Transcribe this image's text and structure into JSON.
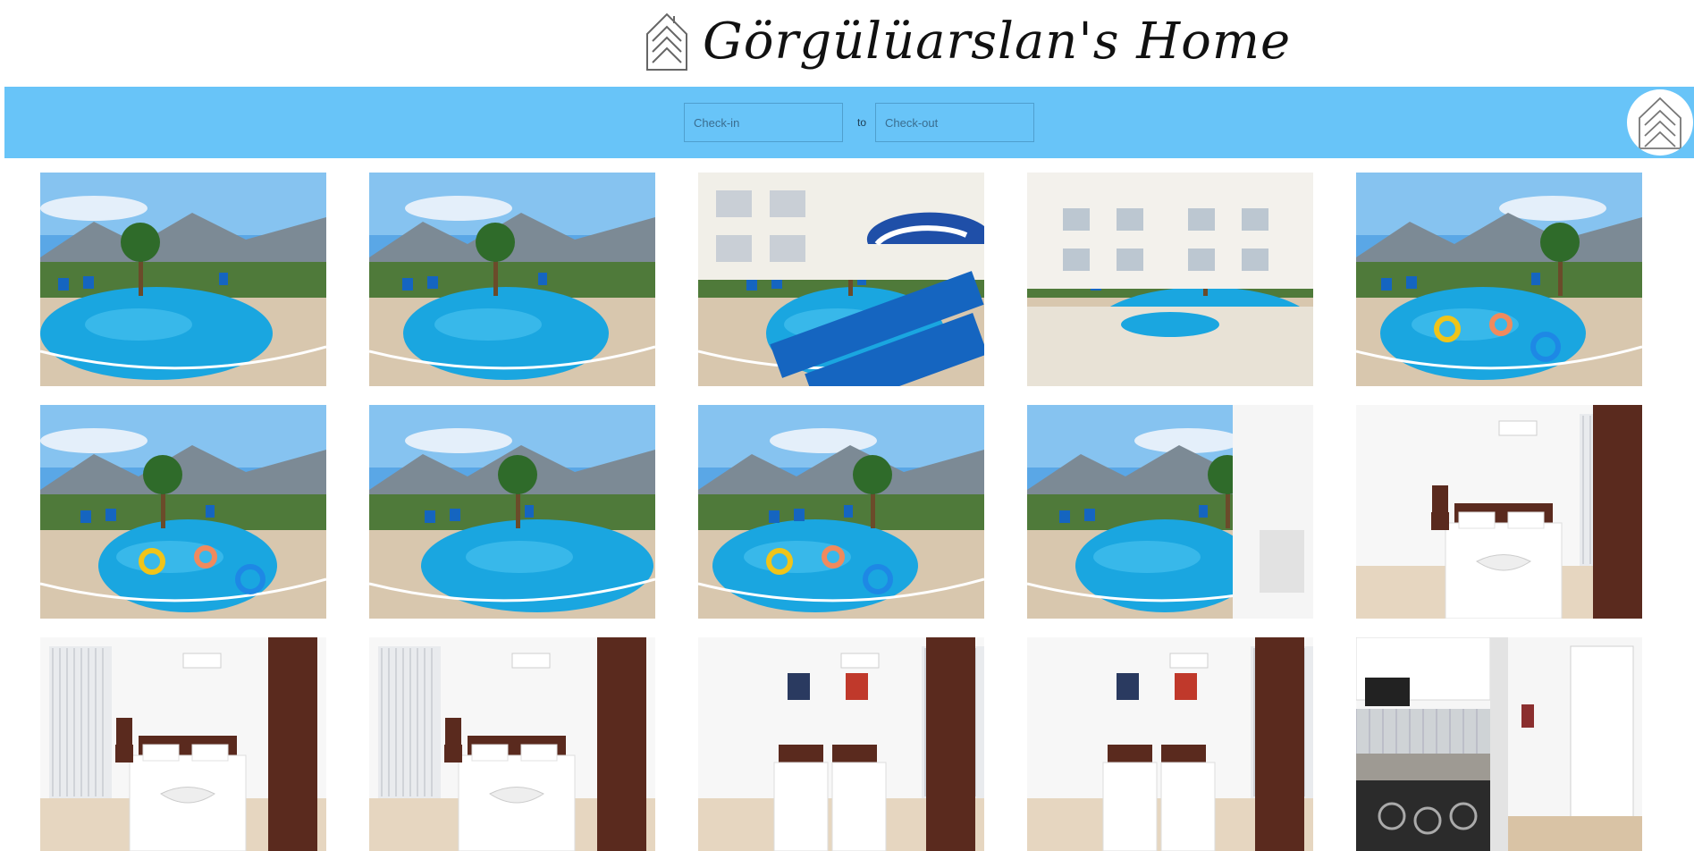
{
  "site": {
    "title": "Görgülüarslan's Home",
    "logo_icon": "house-outline-icon"
  },
  "booking": {
    "checkin_placeholder": "Check-in",
    "to_label": "to",
    "checkout_placeholder": "Check-out",
    "corner_icon": "house-outline-icon"
  },
  "gallery": {
    "photos": [
      {
        "kind": "pool",
        "variant": "wide-pool-mountains"
      },
      {
        "kind": "pool",
        "variant": "pool-garden-banana"
      },
      {
        "kind": "pool",
        "variant": "blue-loungers-umbrella"
      },
      {
        "kind": "pool",
        "variant": "building-jacuzzi"
      },
      {
        "kind": "pool",
        "variant": "pool-floats-sunset"
      },
      {
        "kind": "pool",
        "variant": "pool-floats-closeup"
      },
      {
        "kind": "pool",
        "variant": "pool-clouds-mountains"
      },
      {
        "kind": "pool",
        "variant": "pool-floats-sun"
      },
      {
        "kind": "pool",
        "variant": "pool-from-balcony"
      },
      {
        "kind": "bedroom",
        "variant": "double-bed-door"
      },
      {
        "kind": "bedroom",
        "variant": "double-bed-curtains"
      },
      {
        "kind": "bedroom",
        "variant": "double-bed-window"
      },
      {
        "kind": "bedroom",
        "variant": "twin-beds-wardrobe"
      },
      {
        "kind": "bedroom",
        "variant": "twin-beds-paintings"
      },
      {
        "kind": "kitchen",
        "variant": "kitchen-entrance"
      }
    ]
  },
  "colors": {
    "bar": "#68c4f8",
    "sky": "#5aa7e6",
    "water": "#1aa6e0",
    "lounger": "#1565c0",
    "wall": "#f2f2f0",
    "wood": "#5a2a1e"
  }
}
